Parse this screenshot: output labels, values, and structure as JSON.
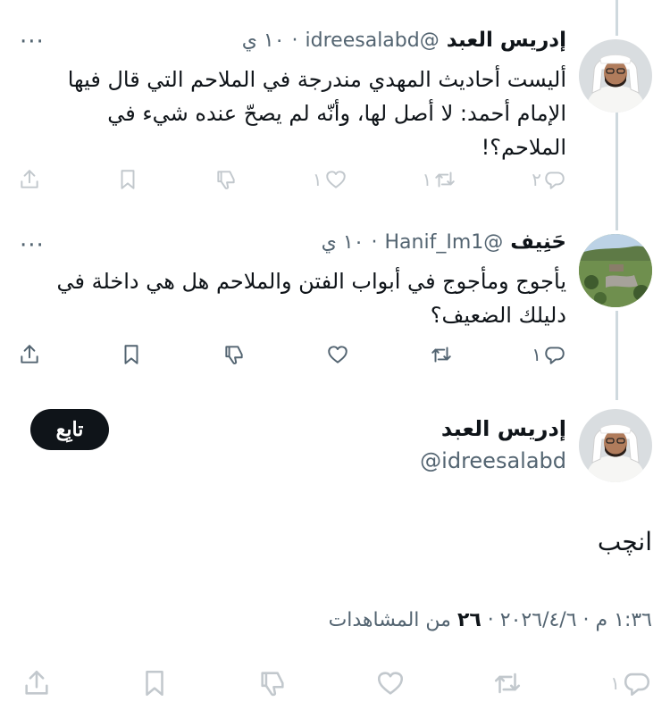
{
  "tweets": [
    {
      "name": "إدريس العبد",
      "handle": "@idreesalabd",
      "dot": "·",
      "time": "١٠ ي",
      "more": "···",
      "text": "أليست أحاديث المهدي مندرجة في الملاحم التي قال فيها الإمام أحمد: لا أصل لها، وأنّه لم يصحّ عنده شيء في الملاحم؟!",
      "counts": {
        "reply": "٢",
        "retweet": "١",
        "like": "١"
      }
    },
    {
      "name": "حَنِيف",
      "handle": "@Hanif_Im1",
      "dot": "·",
      "time": "١٠ ي",
      "more": "···",
      "text": "يأجوج ومأجوج في أبواب الفتن والملاحم هل هي داخلة في دليلك الضعيف؟",
      "counts": {
        "reply": "١",
        "retweet": "",
        "like": ""
      }
    }
  ],
  "main": {
    "name": "إدريس العبد",
    "handle": "@idreesalabd",
    "follow_label": "تابِع",
    "text": "انچب",
    "meta": {
      "datetime": "١:٣٦ م · ٢٠٢٦/٤/٦",
      "separator": "·",
      "views_count": "٢٦",
      "views_label": "من المشاهدات"
    }
  },
  "icons": [
    "reply-icon",
    "retweet-icon",
    "like-icon",
    "dislike-icon",
    "bookmark-icon",
    "share-icon"
  ]
}
